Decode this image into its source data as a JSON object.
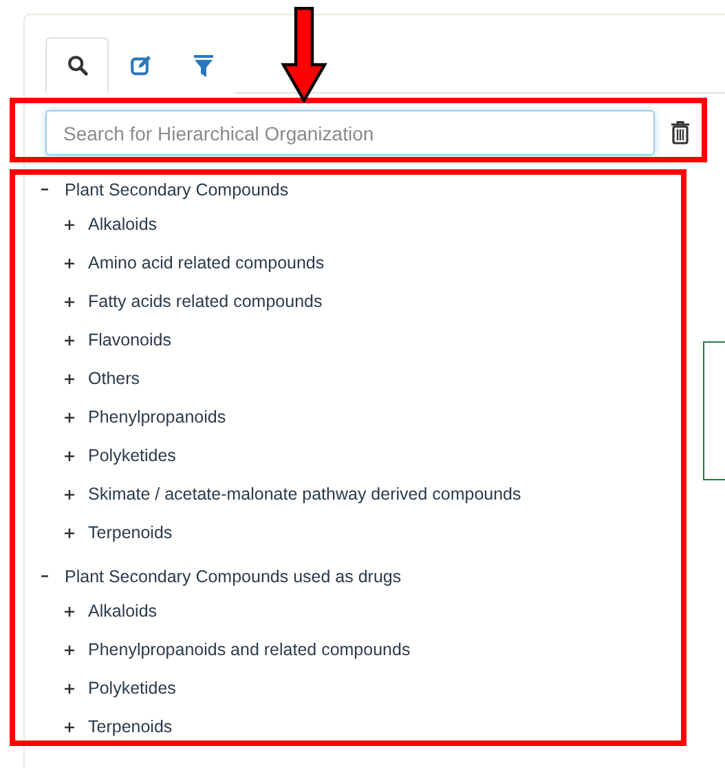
{
  "tabs": [
    {
      "kind": "search",
      "selected": true
    },
    {
      "kind": "edit",
      "selected": false
    },
    {
      "kind": "filter",
      "selected": false
    }
  ],
  "search": {
    "placeholder": "Search for Hierarchical Organization"
  },
  "tree": [
    {
      "label": "Plant Secondary Compounds",
      "expanded": true,
      "children": [
        {
          "label": "Alkaloids",
          "expanded": false
        },
        {
          "label": "Amino acid related compounds",
          "expanded": false
        },
        {
          "label": "Fatty acids related compounds",
          "expanded": false
        },
        {
          "label": "Flavonoids",
          "expanded": false
        },
        {
          "label": "Others",
          "expanded": false
        },
        {
          "label": "Phenylpropanoids",
          "expanded": false
        },
        {
          "label": "Polyketides",
          "expanded": false
        },
        {
          "label": "Skimate / acetate-malonate pathway derived compounds",
          "expanded": false
        },
        {
          "label": "Terpenoids",
          "expanded": false
        }
      ]
    },
    {
      "label": "Plant Secondary Compounds used as drugs",
      "expanded": true,
      "children": [
        {
          "label": "Alkaloids",
          "expanded": false
        },
        {
          "label": "Phenylpropanoids and related compounds",
          "expanded": false
        },
        {
          "label": "Polyketides",
          "expanded": false
        },
        {
          "label": "Terpenoids",
          "expanded": false
        }
      ]
    }
  ]
}
